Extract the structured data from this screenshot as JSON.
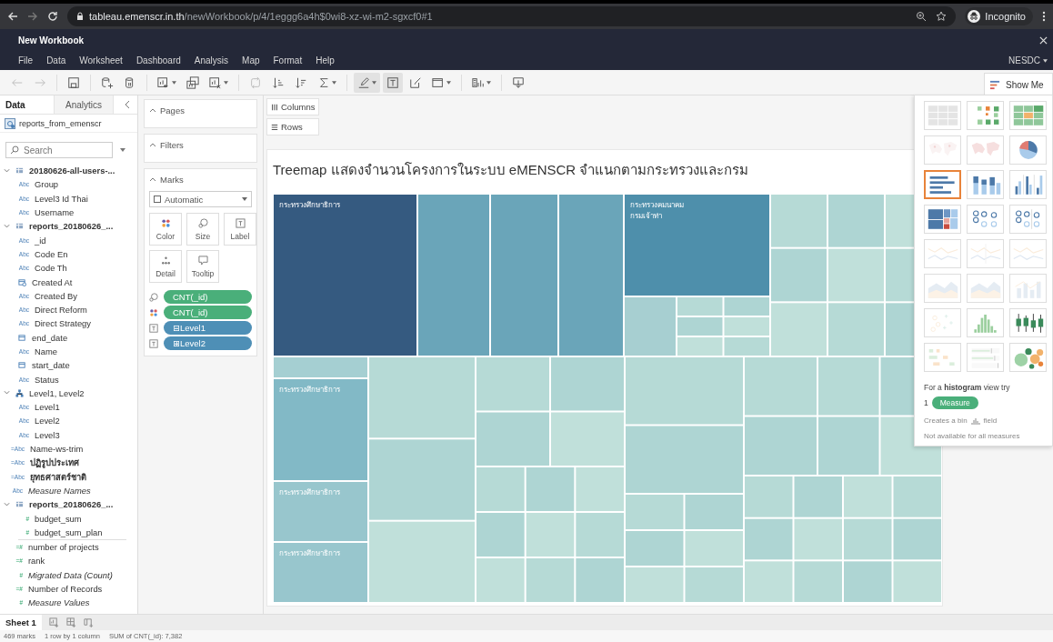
{
  "browser": {
    "url_host": "tableau.emenscr.in.th",
    "url_path": "/newWorkbook/p/4/1eggg6a4h$0wi8-xz-wi-m2-sgxcf0#1",
    "profile": "Incognito"
  },
  "app": {
    "title": "New Workbook",
    "menu": [
      "File",
      "Data",
      "Worksheet",
      "Dashboard",
      "Analysis",
      "Map",
      "Format",
      "Help"
    ],
    "account": "NESDC"
  },
  "toolbar": [
    {
      "kind": "back",
      "disabled": true,
      "pressed": false,
      "dropdown": false
    },
    {
      "kind": "forward",
      "disabled": true,
      "pressed": false,
      "dropdown": false
    },
    {
      "kind": "save",
      "disabled": false,
      "pressed": false,
      "dropdown": false
    },
    {
      "kind": "new-data-source",
      "disabled": false,
      "pressed": false,
      "dropdown": false
    },
    {
      "kind": "pause-updates",
      "disabled": false,
      "pressed": false,
      "dropdown": false
    },
    {
      "kind": "new-worksheet",
      "disabled": false,
      "pressed": false,
      "dropdown": true
    },
    {
      "kind": "duplicate",
      "disabled": false,
      "pressed": false,
      "dropdown": false
    },
    {
      "kind": "clear",
      "disabled": false,
      "pressed": false,
      "dropdown": true
    },
    {
      "kind": "swap",
      "disabled": true,
      "pressed": false,
      "dropdown": false
    },
    {
      "kind": "sort-ascending",
      "disabled": false,
      "pressed": false,
      "dropdown": false
    },
    {
      "kind": "sort-descending",
      "disabled": false,
      "pressed": false,
      "dropdown": false
    },
    {
      "kind": "totals",
      "disabled": false,
      "pressed": false,
      "dropdown": true
    },
    {
      "kind": "highlight",
      "disabled": false,
      "pressed": true,
      "dropdown": true
    },
    {
      "kind": "labels",
      "disabled": false,
      "pressed": true,
      "dropdown": false
    },
    {
      "kind": "format",
      "disabled": false,
      "pressed": false,
      "dropdown": false
    },
    {
      "kind": "fit",
      "disabled": false,
      "pressed": false,
      "dropdown": true
    },
    {
      "kind": "cards",
      "disabled": false,
      "pressed": false,
      "dropdown": true
    },
    {
      "kind": "presentation",
      "disabled": false,
      "pressed": false,
      "dropdown": false
    }
  ],
  "data_pane": {
    "tabs": [
      {
        "label": "Data",
        "selected": true
      },
      {
        "label": "Analytics",
        "selected": false
      }
    ],
    "source": "reports_from_emenscr",
    "search": {
      "placeholder": "Search"
    },
    "fields": [
      {
        "kind": "table",
        "name": "20180626-all-users-...",
        "expanded": true,
        "children": [
          {
            "kind": "dimension",
            "glyph": "Abc",
            "name": "Group"
          },
          {
            "kind": "dimension",
            "glyph": "Abc",
            "name": "Level3 Id Thai"
          },
          {
            "kind": "dimension",
            "glyph": "Abc",
            "name": "Username"
          }
        ]
      },
      {
        "kind": "table",
        "name": "reports_20180626_...",
        "expanded": true,
        "children": [
          {
            "kind": "dimension",
            "glyph": "Abc",
            "name": "_id"
          },
          {
            "kind": "dimension",
            "glyph": "Abc",
            "name": "Code En"
          },
          {
            "kind": "dimension",
            "glyph": "Abc",
            "name": "Code Th"
          },
          {
            "kind": "datetime",
            "name": "Created At"
          },
          {
            "kind": "dimension",
            "glyph": "Abc",
            "name": "Created By"
          },
          {
            "kind": "dimension",
            "glyph": "Abc",
            "name": "Direct Reform"
          },
          {
            "kind": "dimension",
            "glyph": "Abc",
            "name": "Direct Strategy"
          },
          {
            "kind": "date",
            "name": "end_date"
          },
          {
            "kind": "dimension",
            "glyph": "Abc",
            "name": "Name"
          },
          {
            "kind": "date",
            "name": "start_date"
          },
          {
            "kind": "dimension",
            "glyph": "Abc",
            "name": "Status"
          }
        ]
      },
      {
        "kind": "hierarchy",
        "name": "Level1, Level2",
        "expanded": true,
        "children": [
          {
            "kind": "dimension",
            "glyph": "Abc",
            "name": "Level1"
          },
          {
            "kind": "dimension",
            "glyph": "Abc",
            "name": "Level2"
          },
          {
            "kind": "dimension",
            "glyph": "Abc",
            "name": "Level3"
          }
        ]
      },
      {
        "kind": "calc-dimension",
        "glyph": "=Abc",
        "name": "Name-ws-trim"
      },
      {
        "kind": "calc-dimension",
        "glyph": "=Abc",
        "name": "ปฏิรูปประเทศ",
        "bold": true
      },
      {
        "kind": "calc-dimension",
        "glyph": "=Abc",
        "name": "ยุทธศาสตร์ชาติ",
        "bold": true
      },
      {
        "kind": "dimension",
        "glyph": "Abc",
        "name": "Measure Names",
        "italic": true
      },
      {
        "kind": "table",
        "name": "reports_20180626_...",
        "expanded": true,
        "children": [
          {
            "kind": "measure",
            "glyph": "#",
            "name": "budget_sum"
          },
          {
            "kind": "measure",
            "glyph": "#",
            "name": "budget_sum_plan"
          }
        ]
      },
      {
        "kind": "calc-measure",
        "glyph": "=#",
        "name": "number of projects"
      },
      {
        "kind": "calc-measure",
        "glyph": "=#",
        "name": "rank"
      },
      {
        "kind": "measure",
        "glyph": "#",
        "name": "Migrated Data (Count)",
        "italic": true
      },
      {
        "kind": "calc-measure",
        "glyph": "=#",
        "name": "Number of Records"
      },
      {
        "kind": "measure",
        "glyph": "#",
        "name": "Measure Values",
        "italic": true
      }
    ]
  },
  "shelves": {
    "pages": "Pages",
    "filters": "Filters",
    "columns": "Columns",
    "rows": "Rows",
    "marks": {
      "label": "Marks",
      "mark_type": "Automatic",
      "cards": [
        {
          "kind": "color",
          "label": "Color"
        },
        {
          "kind": "size",
          "label": "Size"
        },
        {
          "kind": "label",
          "label": "Label"
        },
        {
          "kind": "detail",
          "label": "Detail"
        },
        {
          "kind": "tooltip",
          "label": "Tooltip"
        }
      ],
      "pills": [
        {
          "kind": "size",
          "color": "#4aaf7a",
          "text": "CNT(_id)"
        },
        {
          "kind": "color",
          "color": "#4aaf7a",
          "text": "CNT(_id)"
        },
        {
          "kind": "label",
          "color": "#4e8fb6",
          "text": "⊟Level1"
        },
        {
          "kind": "label",
          "color": "#4e8fb6",
          "text": "⊞Level2"
        }
      ]
    }
  },
  "view": {
    "title": "Treemap แสดงจำนวนโครงการในระบบ eMENSCR จำแนกตามกระทรวงและกรม",
    "labels": [
      {
        "lines": [
          "กระทรวงศึกษาธิการ"
        ]
      },
      {
        "lines": [
          "กระทรวงคมนาคม",
          "กรมเจ้าท่า"
        ]
      },
      {
        "lines": [
          "กระทรวงศึกษาธิการ"
        ]
      },
      {
        "lines": [
          "กระทรวงศึกษาธิการ"
        ]
      },
      {
        "lines": [
          "กระทรวงศึกษาธิการ"
        ]
      }
    ]
  },
  "show_me": {
    "label": "Show Me",
    "tiles": [
      {
        "kind": "text-table",
        "available": true,
        "selected": false
      },
      {
        "kind": "heat-map",
        "available": true,
        "selected": false
      },
      {
        "kind": "highlight-table",
        "available": true,
        "selected": false
      },
      {
        "kind": "symbol-map",
        "available": false,
        "selected": false
      },
      {
        "kind": "filled-map",
        "available": false,
        "selected": false
      },
      {
        "kind": "pie-chart",
        "available": true,
        "selected": false
      },
      {
        "kind": "horizontal-bars",
        "available": true,
        "selected": true
      },
      {
        "kind": "stacked-bars",
        "available": true,
        "selected": false
      },
      {
        "kind": "side-by-side-bars",
        "available": true,
        "selected": false
      },
      {
        "kind": "treemap",
        "available": true,
        "selected": false
      },
      {
        "kind": "circle-view",
        "available": true,
        "selected": false
      },
      {
        "kind": "side-by-side-circles",
        "available": true,
        "selected": false
      },
      {
        "kind": "continuous-lines",
        "available": false,
        "selected": false
      },
      {
        "kind": "discrete-lines",
        "available": false,
        "selected": false
      },
      {
        "kind": "dual-lines",
        "available": false,
        "selected": false
      },
      {
        "kind": "continuous-area",
        "available": false,
        "selected": false
      },
      {
        "kind": "discrete-area",
        "available": false,
        "selected": false
      },
      {
        "kind": "dual-combination",
        "available": false,
        "selected": false
      },
      {
        "kind": "scatter-plot",
        "available": false,
        "selected": false
      },
      {
        "kind": "histogram",
        "available": true,
        "selected": false
      },
      {
        "kind": "box-plot",
        "available": true,
        "selected": false
      },
      {
        "kind": "gantt-chart",
        "available": false,
        "selected": false
      },
      {
        "kind": "bullet-graph",
        "available": false,
        "selected": false
      },
      {
        "kind": "packed-bubbles",
        "available": true,
        "selected": false
      }
    ],
    "hint": "For a **histogram** view try",
    "hint_count": "1",
    "hint_pill": "Measure",
    "bin_before": "Creates a bin",
    "bin_after": "field",
    "note": "Not available for all measures"
  },
  "sheets": [
    {
      "label": "Sheet 1",
      "selected": true
    }
  ],
  "status": [
    "469 marks",
    "1 row by 1 column",
    "SUM of CNT(_id): 7,382"
  ]
}
